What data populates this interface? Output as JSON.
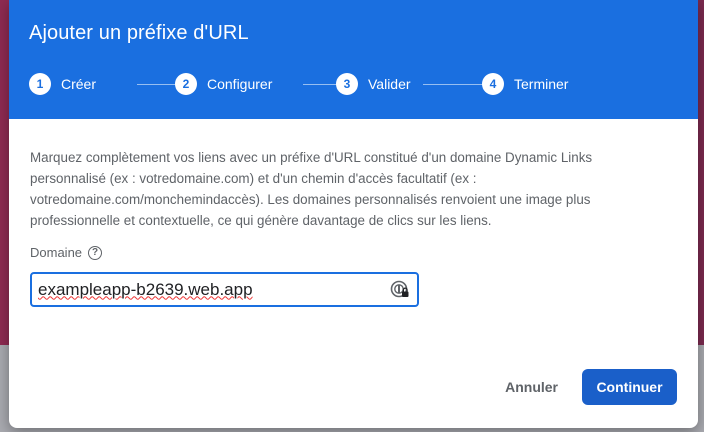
{
  "dialog": {
    "title": "Ajouter un préfixe d'URL",
    "steps": [
      {
        "num": "1",
        "label": "Créer"
      },
      {
        "num": "2",
        "label": "Configurer"
      },
      {
        "num": "3",
        "label": "Valider"
      },
      {
        "num": "4",
        "label": "Terminer"
      }
    ],
    "description": "Marquez complètement vos liens avec un préfixe d'URL constitué d'un domaine Dynamic Links personnalisé (ex : votredomaine.com) et d'un chemin d'accès facultatif (ex : votredomaine.com/monchemindaccès). Les domaines personnalisés renvoient une image plus professionnelle et contextuelle, ce qui génère davantage de clics sur les liens.",
    "field_label": "Domaine",
    "help_glyph": "?",
    "domain_value": "exampleapp-b2639.web.app",
    "cancel_label": "Annuler",
    "continue_label": "Continuer"
  },
  "colors": {
    "header": "#1a6fe0",
    "primary_button": "#1a5fc9",
    "text_secondary": "#5f6368"
  },
  "icons": {
    "help": "question-circle-icon",
    "password_manager": "lock-key-icon"
  }
}
